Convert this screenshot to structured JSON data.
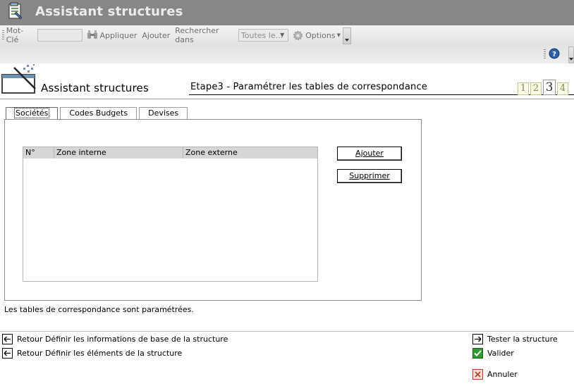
{
  "window": {
    "title": "Assistant structures"
  },
  "toolbar": {
    "keyword_label": "Mot-Clé",
    "keyword_value": "",
    "apply_label": "Appliquer",
    "add_label": "Ajouter",
    "search_in_label": "Rechercher dans",
    "search_in_value": "Toutes le...",
    "options_label": "Options"
  },
  "header": {
    "wizard_title": "Assistant structures",
    "step_title": "Etape3 - Paramétrer les tables de correspondance",
    "steps": [
      "1",
      "2",
      "3",
      "4"
    ],
    "current_step": "3"
  },
  "tabs": [
    {
      "label": "Sociétés",
      "active": true
    },
    {
      "label": "Codes Budgets",
      "active": false
    },
    {
      "label": "Devises",
      "active": false
    }
  ],
  "grid": {
    "columns": [
      "N°",
      "Zone interne",
      "Zone externe"
    ],
    "rows": []
  },
  "buttons": {
    "add_label": "Ajouter",
    "delete_label": "Supprimer"
  },
  "status_message": "Les tables de correspondance sont paramétrées.",
  "footer": {
    "back1": "Retour Définir les informations de base de la structure",
    "back2": "Retour Définir les éléments de la structure",
    "test": "Tester la structure",
    "validate": "Valider",
    "cancel": "Annuler"
  },
  "colors": {
    "titlebar": "#878787",
    "step_badge": "#fbfbe9",
    "validate_icon": "#2f9a2f",
    "cancel_icon": "#b0472f"
  }
}
